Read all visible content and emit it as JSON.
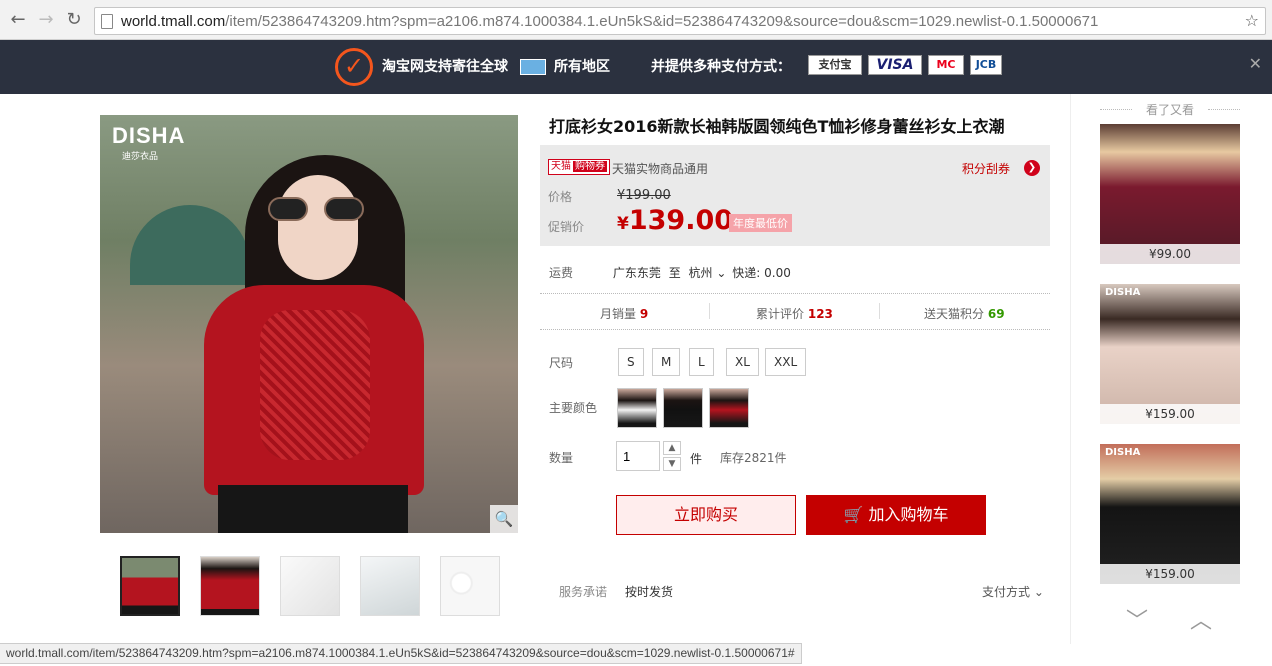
{
  "browser": {
    "url_host": "world.tmall.com",
    "url_path": "/item/523864743209.htm?spm=a2106.m874.1000384.1.eUn5kS&id=523864743209&source=dou&scm=1029.newlist-0.1.50000671",
    "status_url": "world.tmall.com/item/523864743209.htm?spm=a2106.m874.1000384.1.eUn5kS&id=523864743209&source=dou&scm=1029.newlist-0.1.50000671#"
  },
  "banner": {
    "ship_text": "淘宝网支持寄往全球",
    "region_text": "所有地区",
    "payment_text": "并提供多种支付方式：",
    "payments": [
      "支付宝",
      "VISA",
      "MC",
      "JCB"
    ]
  },
  "gallery": {
    "brand_logo": "DISHA",
    "brand_sub": "迪莎衣品"
  },
  "product": {
    "title": "打底衫女2016新款长袖韩版圆领纯色T恤衫修身蕾丝衫女上衣潮",
    "tag_tmall": "天猫",
    "tag_coupon": "购物券",
    "coupon_text": "天猫实物商品通用",
    "points_link": "积分刮券",
    "price_label": "价格",
    "original_price": "¥199.00",
    "promo_label": "促销价",
    "currency": "¥",
    "promo_price": "139.00",
    "promo_badge": "年度最低价",
    "shipping_label": "运费",
    "shipping_from": "广东东莞",
    "shipping_to_word": "至",
    "shipping_to": "杭州",
    "shipping_fee": "快递: 0.00",
    "monthly_sales_label": "月销量",
    "monthly_sales": "9",
    "reviews_label": "累计评价",
    "reviews": "123",
    "points_label": "送天猫积分",
    "points": "69",
    "size_label": "尺码",
    "sizes": [
      "S",
      "M",
      "L",
      "XL",
      "XXL"
    ],
    "color_label": "主要颜色",
    "qty_label": "数量",
    "qty_value": "1",
    "qty_unit": "件",
    "stock": "库存2821件",
    "buy_now": "立即购买",
    "add_cart": "加入购物车",
    "service_label": "服务承诺",
    "service_value": "按时发货",
    "payment_methods": "支付方式"
  },
  "side": {
    "title": "看了又看",
    "items": [
      {
        "price": "¥99.00"
      },
      {
        "price": "¥159.00",
        "logo": "DISHA"
      },
      {
        "price": "¥159.00",
        "logo": "DISHA"
      }
    ]
  },
  "colors": {
    "accent": "#c40000",
    "banner_bg": "#2b313f"
  }
}
